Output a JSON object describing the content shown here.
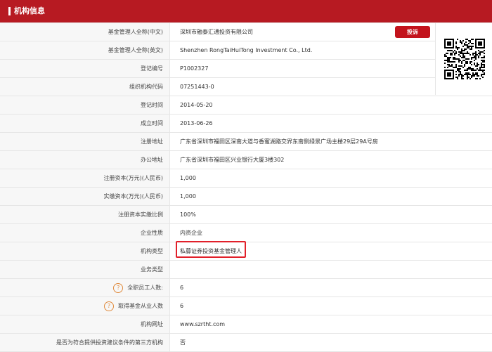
{
  "header": {
    "title": "机构信息"
  },
  "actions": {
    "complain_label": "投诉"
  },
  "rows": [
    {
      "label": "基金管理人全称(中文)",
      "value": "深圳市融泰汇通投资有限公司"
    },
    {
      "label": "基金管理人全称(英文)",
      "value": "Shenzhen RongTaiHuiTong Investment Co., Ltd."
    },
    {
      "label": "登记编号",
      "value": "P1002327"
    },
    {
      "label": "组织机构代码",
      "value": "07251443-0"
    },
    {
      "label": "登记时间",
      "value": "2014-05-20"
    },
    {
      "label": "成立时间",
      "value": "2013-06-26"
    },
    {
      "label": "注册地址",
      "value": "广东省深圳市福田区深南大道与香蜜湖路交界东南侧绿景广场主楼29层29A号房"
    },
    {
      "label": "办公地址",
      "value": "广东省深圳市福田区兴业银行大厦3楼302"
    },
    {
      "label": "注册资本(万元)(人民币)",
      "value": "1,000"
    },
    {
      "label": "实缴资本(万元)(人民币)",
      "value": "1,000"
    },
    {
      "label": "注册资本实缴比例",
      "value": "100%"
    },
    {
      "label": "企业性质",
      "value": "内资企业"
    },
    {
      "label": "机构类型",
      "value": "私募证券投资基金管理人"
    },
    {
      "label": "业务类型",
      "value": ""
    },
    {
      "label": "全职员工人数:",
      "value": "6",
      "help": "?"
    },
    {
      "label": "取得基金从业人数",
      "value": "6",
      "help": "?"
    },
    {
      "label": "机构网址",
      "value": "www.szrtht.com"
    },
    {
      "label": "是否为符合提供投资建议条件的第三方机构",
      "value": "否"
    }
  ],
  "icons": {
    "qr": "qr-code-icon",
    "help": "question-circle-icon"
  },
  "colors": {
    "brand": "#b71a22",
    "button": "#c3131c",
    "highlight": "#e1202a",
    "help": "#e08a3c"
  }
}
